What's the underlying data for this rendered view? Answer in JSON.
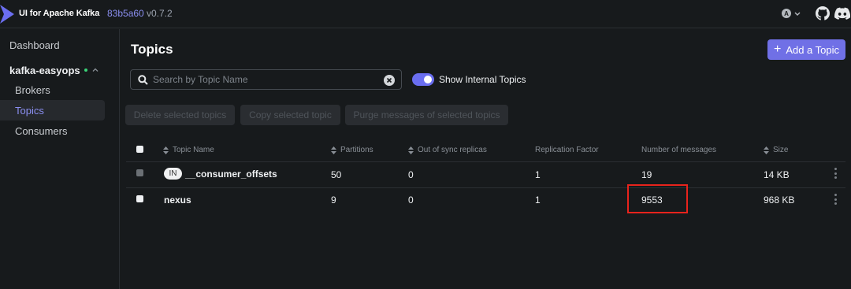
{
  "app": {
    "title": "UI for Apache Kafka",
    "version_hash": "83b5a60",
    "version": "v0.7.2",
    "theme_icon_letter": "A",
    "brand_color": "#6b6ef0"
  },
  "sidebar": {
    "dashboard_label": "Dashboard",
    "cluster_name": "kafka-easyops",
    "cluster_status": "online",
    "items": [
      {
        "label": "Brokers",
        "active": false
      },
      {
        "label": "Topics",
        "active": true
      },
      {
        "label": "Consumers",
        "active": false
      }
    ]
  },
  "page": {
    "title": "Topics",
    "add_button_label": "Add a Topic",
    "add_button_icon": "plus-icon"
  },
  "search": {
    "placeholder": "Search by Topic Name",
    "value": ""
  },
  "toggle": {
    "label": "Show Internal Topics",
    "checked": true
  },
  "bulk_actions": {
    "delete_label": "Delete selected topics",
    "copy_label": "Copy selected topic",
    "purge_label": "Purge messages of selected topics"
  },
  "table": {
    "columns": {
      "topic_name": "Topic Name",
      "partitions": "Partitions",
      "out_of_sync": "Out of sync replicas",
      "replication_factor": "Replication Factor",
      "messages": "Number of messages",
      "size": "Size"
    },
    "rows": [
      {
        "internal_badge": "IN",
        "name": "__consumer_offsets",
        "partitions": "50",
        "out_of_sync": "0",
        "replication_factor": "1",
        "messages": "19",
        "size": "14 KB"
      },
      {
        "internal_badge": "",
        "name": "nexus",
        "partitions": "9",
        "out_of_sync": "0",
        "replication_factor": "1",
        "messages": "9553",
        "size": "968 KB"
      }
    ]
  },
  "annotation": {
    "highlight_color": "#e8231c"
  }
}
